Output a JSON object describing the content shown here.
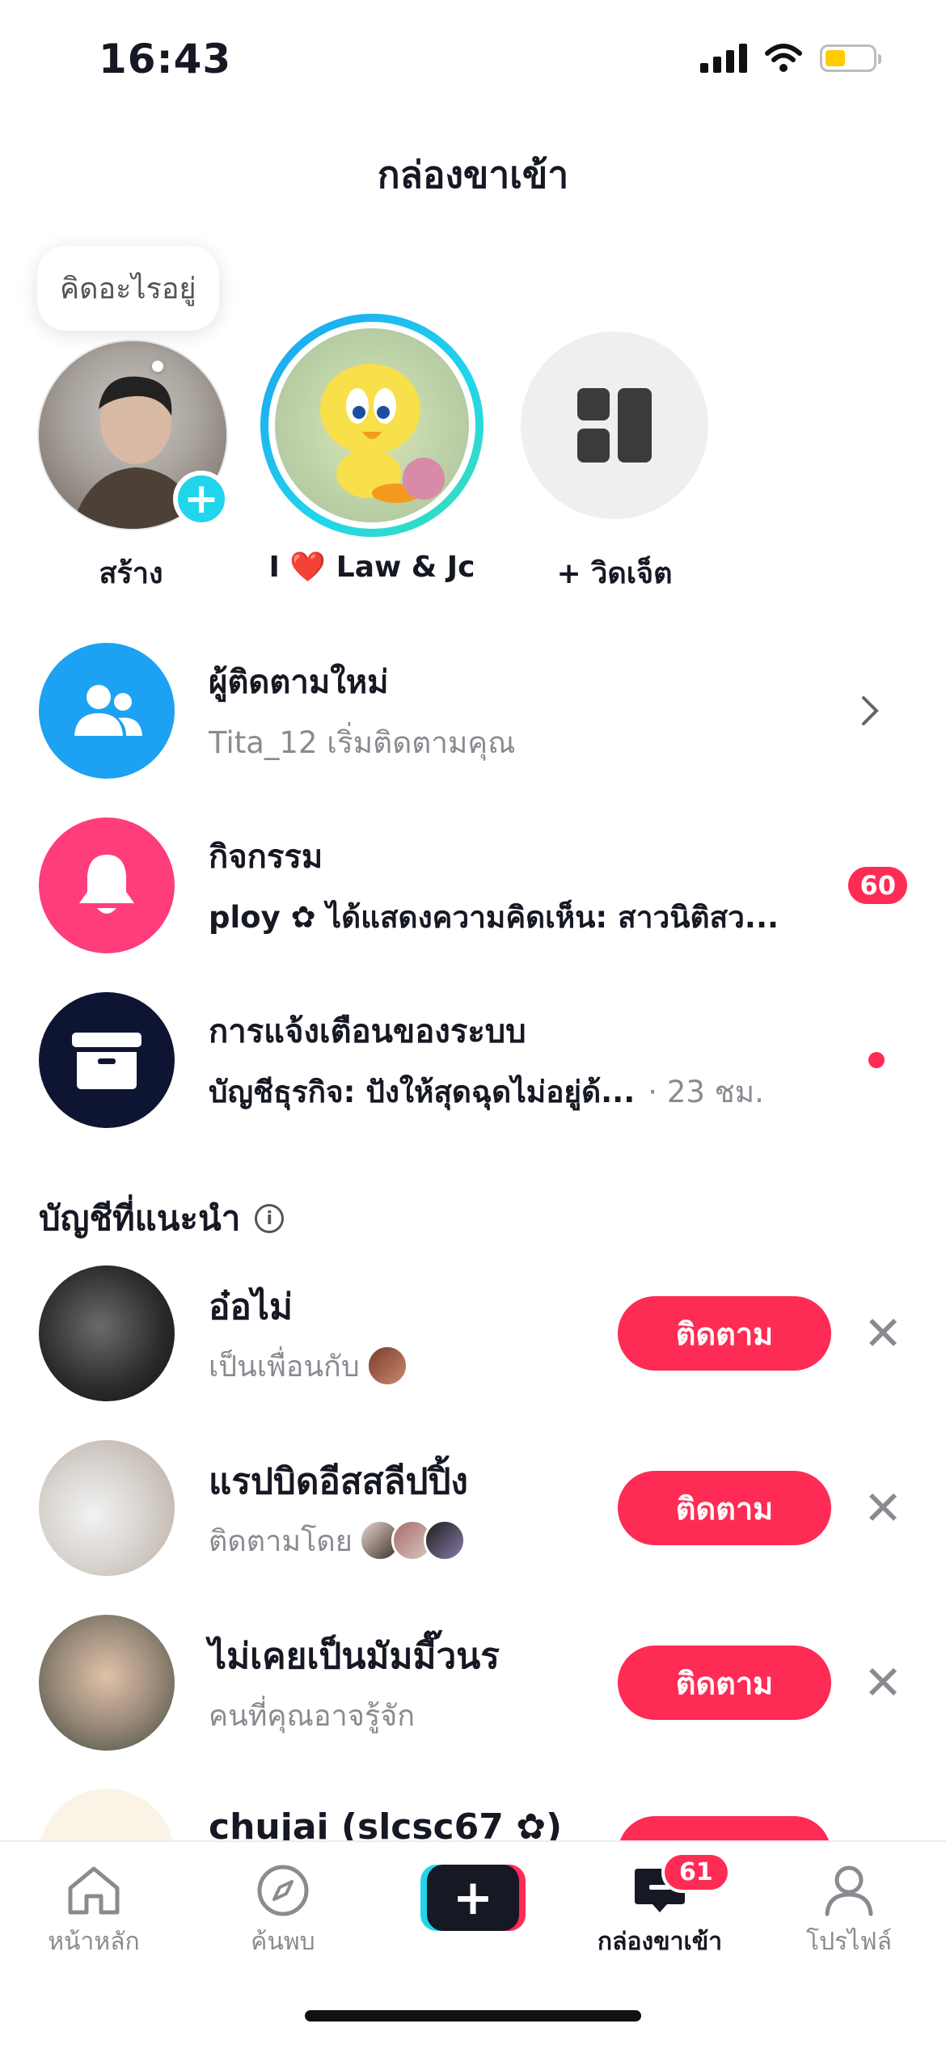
{
  "status_bar": {
    "time": "16:43",
    "battery_level_pct": 30
  },
  "header": {
    "title": "กล่องขาเข้า"
  },
  "stories": {
    "bubble_text": "คิดอะไรอยู่",
    "items": [
      {
        "label": "สร้าง"
      },
      {
        "label": "I ❤️ Law & Jc"
      },
      {
        "label": "+ วิดเจ็ต"
      }
    ]
  },
  "notifications": [
    {
      "title": "ผู้ติดตามใหม่",
      "subtitle": "Tita_12 เริ่มติดตามคุณ"
    },
    {
      "title": "กิจกรรม",
      "subtitle": "ploy ✿ ได้แสดงความคิดเห็น: สาวนิติสว...",
      "badge": "60"
    },
    {
      "title": "การแจ้งเตือนของระบบ",
      "subtitle": "บัญชีธุรกิจ: ปังให้สุดฉุดไม่อยู่ด้...",
      "time": "· 23 ชม."
    }
  ],
  "suggested": {
    "title": "บัญชีที่แนะนำ",
    "follow_label": "ติดตาม",
    "accounts": [
      {
        "name": "อ๋อไม่",
        "subtitle": "เป็นเพื่อนกับ"
      },
      {
        "name": "แรปบิดอีสสลีปปิ้ง",
        "subtitle": "ติดตามโดย"
      },
      {
        "name": "ไม่เคยเป็นมัมมี๊วนร",
        "subtitle": "คนที่คุณอาจรู้จัก"
      },
      {
        "name": "chujai (slcsc67 ✿)"
      }
    ]
  },
  "tabbar": {
    "home": "หน้าหลัก",
    "discover": "ค้นพบ",
    "inbox": "กล่องขาเข้า",
    "inbox_badge": "61",
    "profile": "โปรไฟล์"
  },
  "colors": {
    "accent": "#fe2c55",
    "cyan": "#20d5ec",
    "blue": "#1da1f2",
    "pink": "#fe3d7a",
    "navy": "#0d1533"
  }
}
